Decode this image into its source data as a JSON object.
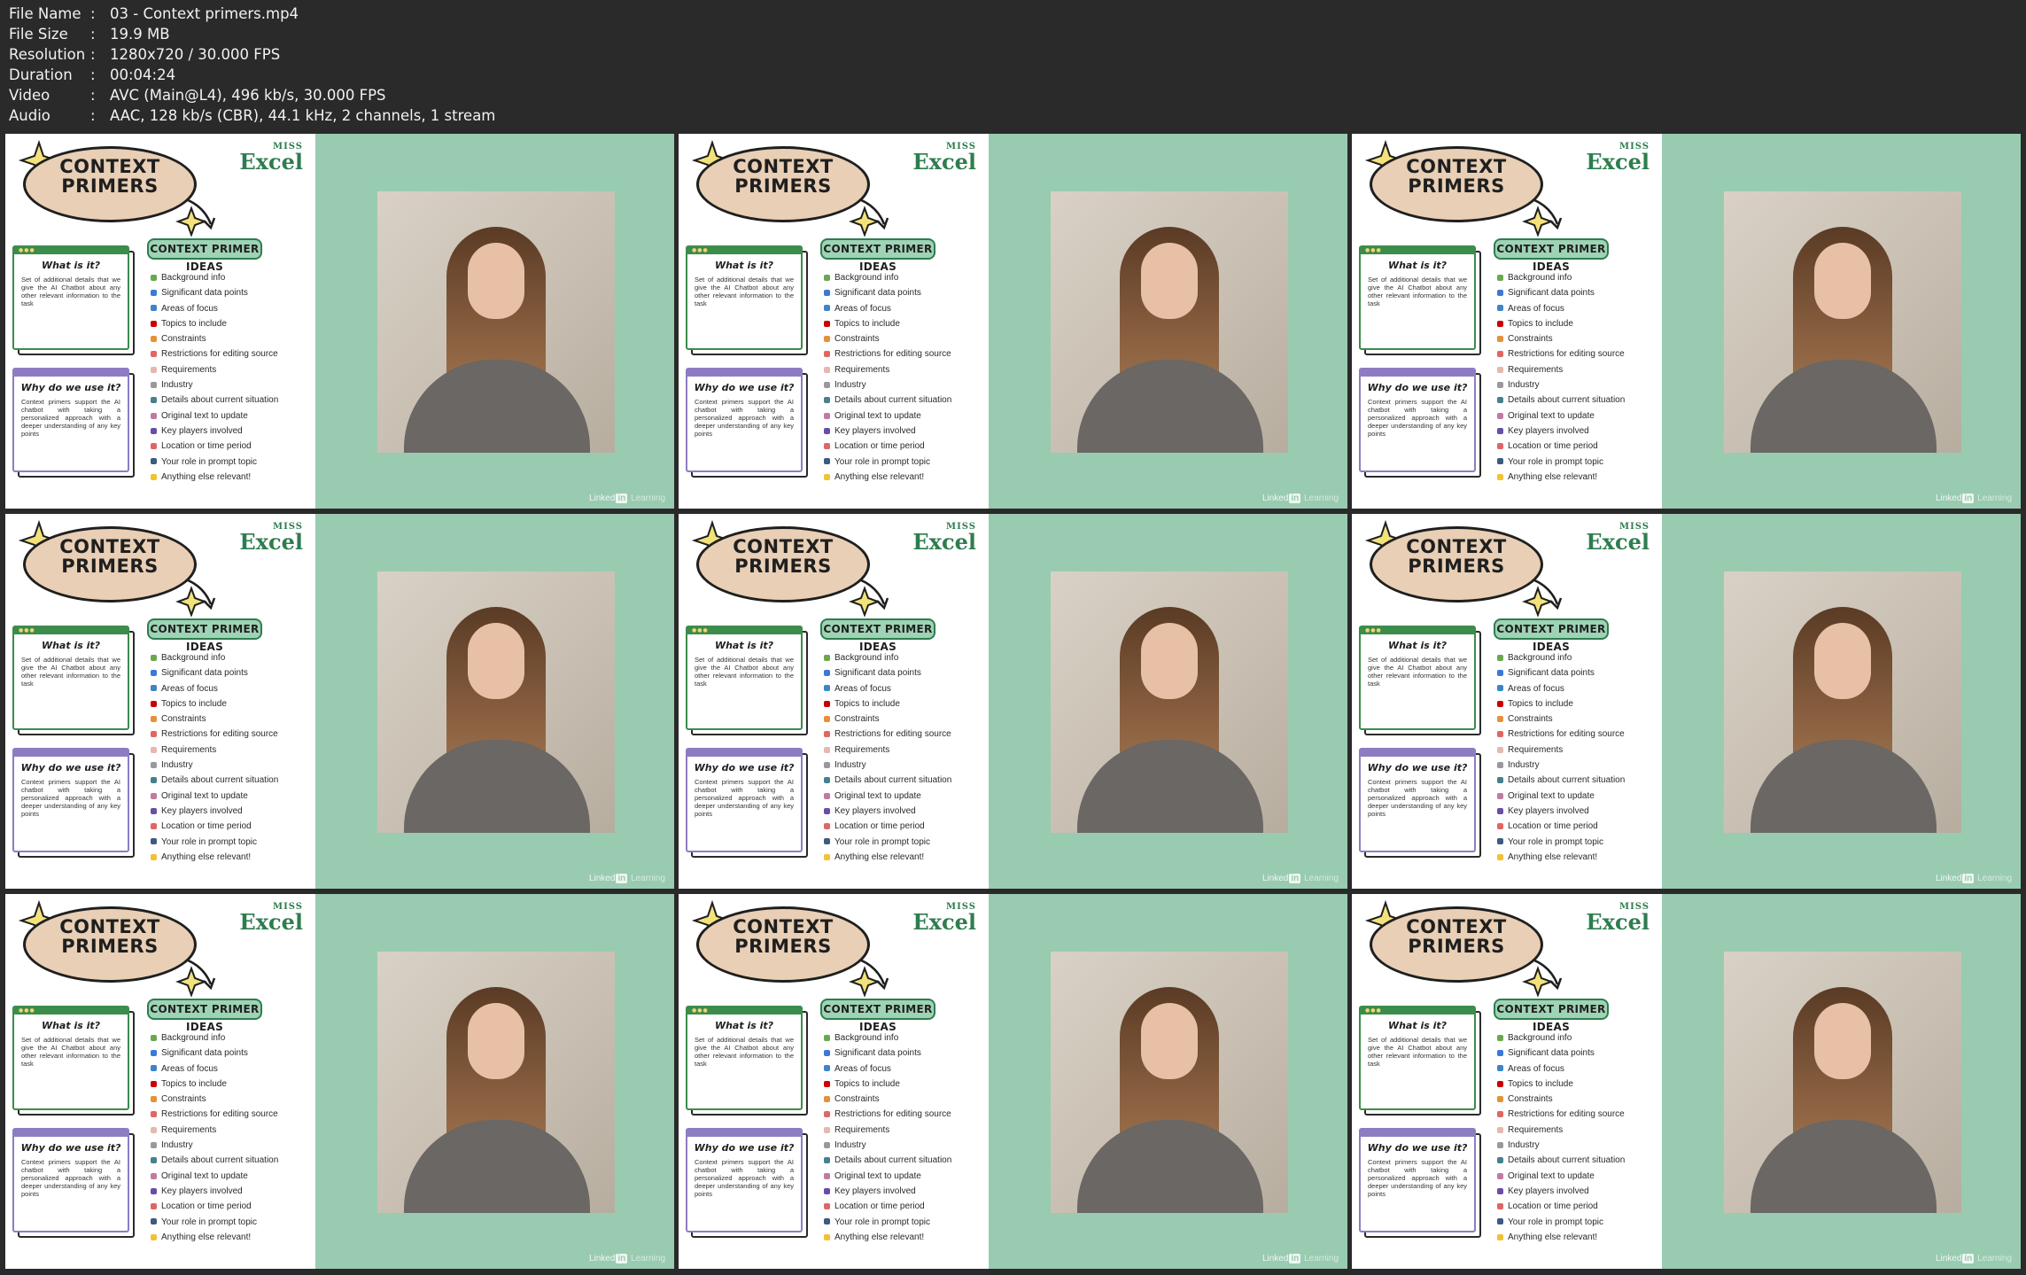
{
  "file_info": [
    {
      "label": "File Name",
      "value": "03 - Context primers.mp4"
    },
    {
      "label": "File Size",
      "value": "19.9 MB"
    },
    {
      "label": "Resolution",
      "value": "1280x720 / 30.000 FPS"
    },
    {
      "label": "Duration",
      "value": "00:04:24"
    },
    {
      "label": "Video",
      "value": "AVC (Main@L4), 496 kb/s, 30.000 FPS"
    },
    {
      "label": "Audio",
      "value": "AAC, 128 kb/s (CBR), 44.1 kHz, 2 channels, 1 stream"
    }
  ],
  "separator": ":",
  "thumbnail_count": 9,
  "slide": {
    "title_line1": "CONTEXT",
    "title_line2": "PRIMERS",
    "logo_top": "MISS",
    "logo_main": "Excel",
    "what_title": "What is it?",
    "what_body": "Set of additional details that we give the AI Chatbot about any other relevant information to the task",
    "why_title": "Why do we use it?",
    "why_body": "Context primers support the AI chatbot with taking a personalized approach with a deeper understanding of any key points",
    "ideas_title": "CONTEXT PRIMER IDEAS",
    "ideas": [
      {
        "label": "Background info",
        "icon": "book-icon",
        "color": "#6aa84f"
      },
      {
        "label": "Significant data points",
        "icon": "bar-chart-icon",
        "color": "#3c78d8"
      },
      {
        "label": "Areas of focus",
        "icon": "target-icon",
        "color": "#3d85c6"
      },
      {
        "label": "Topics to include",
        "icon": "pin-icon",
        "color": "#cc0000"
      },
      {
        "label": "Constraints",
        "icon": "lock-icon",
        "color": "#e69138"
      },
      {
        "label": "Restrictions for editing source",
        "icon": "no-entry-icon",
        "color": "#e06666"
      },
      {
        "label": "Requirements",
        "icon": "checklist-icon",
        "color": "#e6b8af"
      },
      {
        "label": "Industry",
        "icon": "factory-icon",
        "color": "#999999"
      },
      {
        "label": "Details about current situation",
        "icon": "globe-icon",
        "color": "#45818e"
      },
      {
        "label": "Original text to update",
        "icon": "pencil-icon",
        "color": "#c27ba0"
      },
      {
        "label": "Key players involved",
        "icon": "people-icon",
        "color": "#674ea7"
      },
      {
        "label": "Location or time period",
        "icon": "clock-icon",
        "color": "#e06666"
      },
      {
        "label": "Your role in prompt topic",
        "icon": "person-icon",
        "color": "#3d5a80"
      },
      {
        "label": "Anything else relevant!",
        "icon": "hand-icon",
        "color": "#f1c232"
      }
    ]
  },
  "watermark": {
    "brand": "Linked",
    "box": "in",
    "sub": "Learning"
  },
  "colors": {
    "background": "#2a2a2a",
    "green_panel": "#99cbb1",
    "title_oval": "#e8cfb5",
    "what_card_accent": "#3c8c4c",
    "why_card_accent": "#8e7cc3",
    "logo_green": "#2e7d4f"
  }
}
